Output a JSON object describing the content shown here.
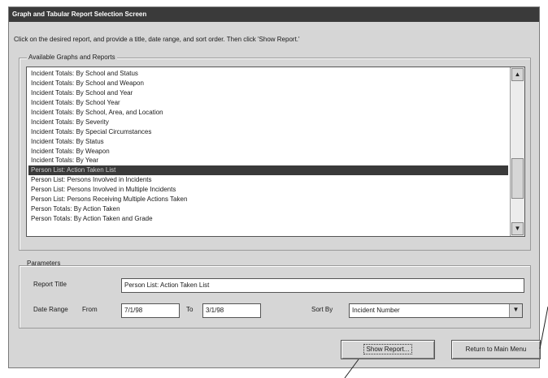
{
  "window": {
    "title": "Graph and Tabular Report Selection Screen",
    "instruction": "Click on the desired report, and provide a title, date range, and sort order.  Then click 'Show Report.'"
  },
  "reports": {
    "group_label": "Available Graphs and Reports",
    "items": [
      "Incident Totals: By School and Status",
      "Incident Totals: By School and Weapon",
      "Incident Totals: By School and Year",
      "Incident Totals: By School Year",
      "Incident Totals: By School, Area, and Location",
      "Incident Totals: By Severity",
      "Incident Totals: By Special Circumstances",
      "Incident Totals: By Status",
      "Incident Totals: By Weapon",
      "Incident Totals: By Year",
      "Person List: Action Taken List",
      "Person List: Persons Involved in Incidents",
      "Person List: Persons Involved in Multiple Incidents",
      "Person List: Persons Receiving Multiple Actions Taken",
      "Person Totals: By Action Taken",
      "Person Totals: By Action Taken and Grade"
    ],
    "selected_index": 10,
    "scroll_up_glyph": "▲",
    "scroll_down_glyph": "▼"
  },
  "parameters": {
    "group_label": "Parameters",
    "report_title_label": "Report Title",
    "report_title_value": "Person List: Action Taken List",
    "date_range_label": "Date Range",
    "from_label": "From",
    "from_value": "7/1/98",
    "to_label": "To",
    "to_value": "3/1/98",
    "sort_by_label": "Sort By",
    "sort_by_value": "Incident Number",
    "dropdown_glyph": "▼"
  },
  "buttons": {
    "show_report": "Show Report...",
    "return_to_main_menu": "Return to Main Menu"
  }
}
